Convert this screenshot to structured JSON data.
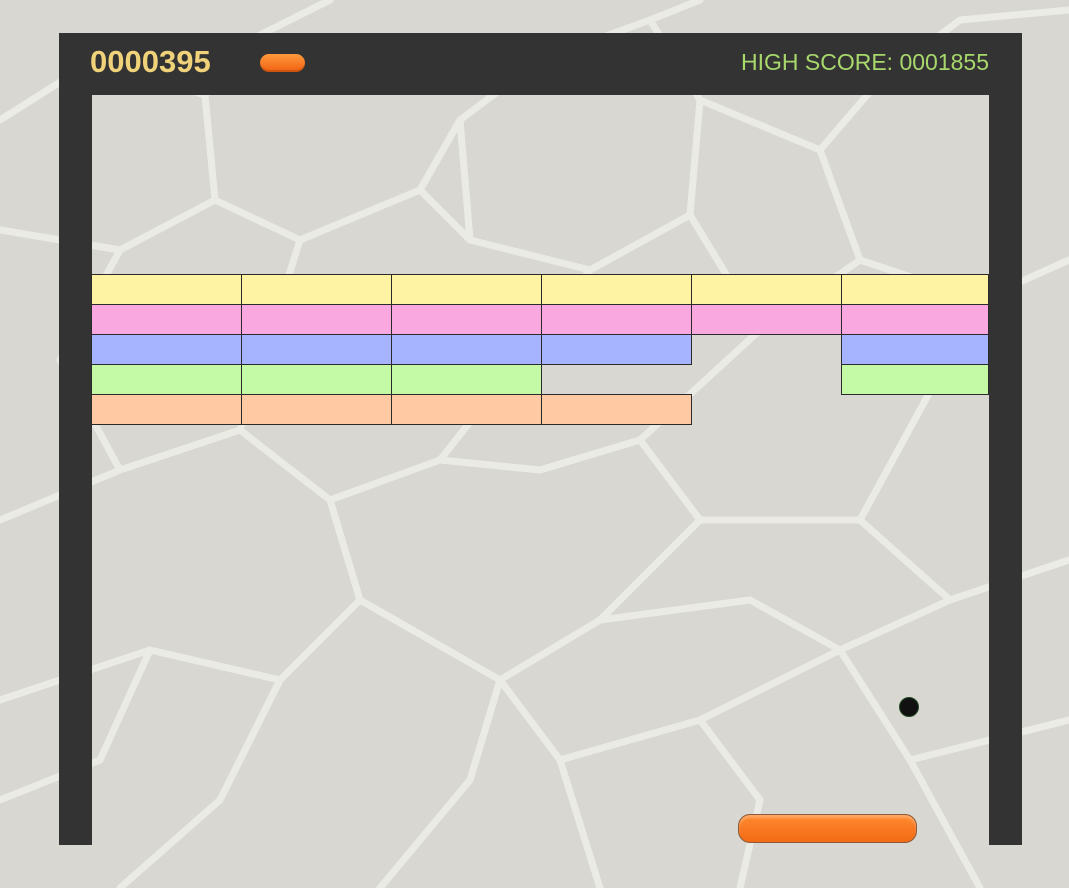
{
  "game": {
    "score": "0000395",
    "high_score_label": "HIGH SCORE: 0001855",
    "lives_remaining": 1
  },
  "colors": {
    "frame": "#333333",
    "score_text": "#f0d27a",
    "high_score_text": "#a8d86c",
    "paddle": "#f47a22",
    "ball": "#111111"
  },
  "bricks": {
    "columns": 6,
    "rows": [
      {
        "color": "#fdf3a3",
        "present": [
          true,
          true,
          true,
          true,
          true,
          true
        ]
      },
      {
        "color": "#f9a9e0",
        "present": [
          true,
          true,
          true,
          true,
          true,
          true
        ]
      },
      {
        "color": "#a6b4ff",
        "present": [
          true,
          true,
          true,
          true,
          false,
          true
        ]
      },
      {
        "color": "#c4f9a6",
        "present": [
          true,
          true,
          true,
          false,
          false,
          true
        ]
      },
      {
        "color": "#fec9a3",
        "present": [
          true,
          true,
          true,
          true,
          false,
          false
        ]
      }
    ]
  }
}
